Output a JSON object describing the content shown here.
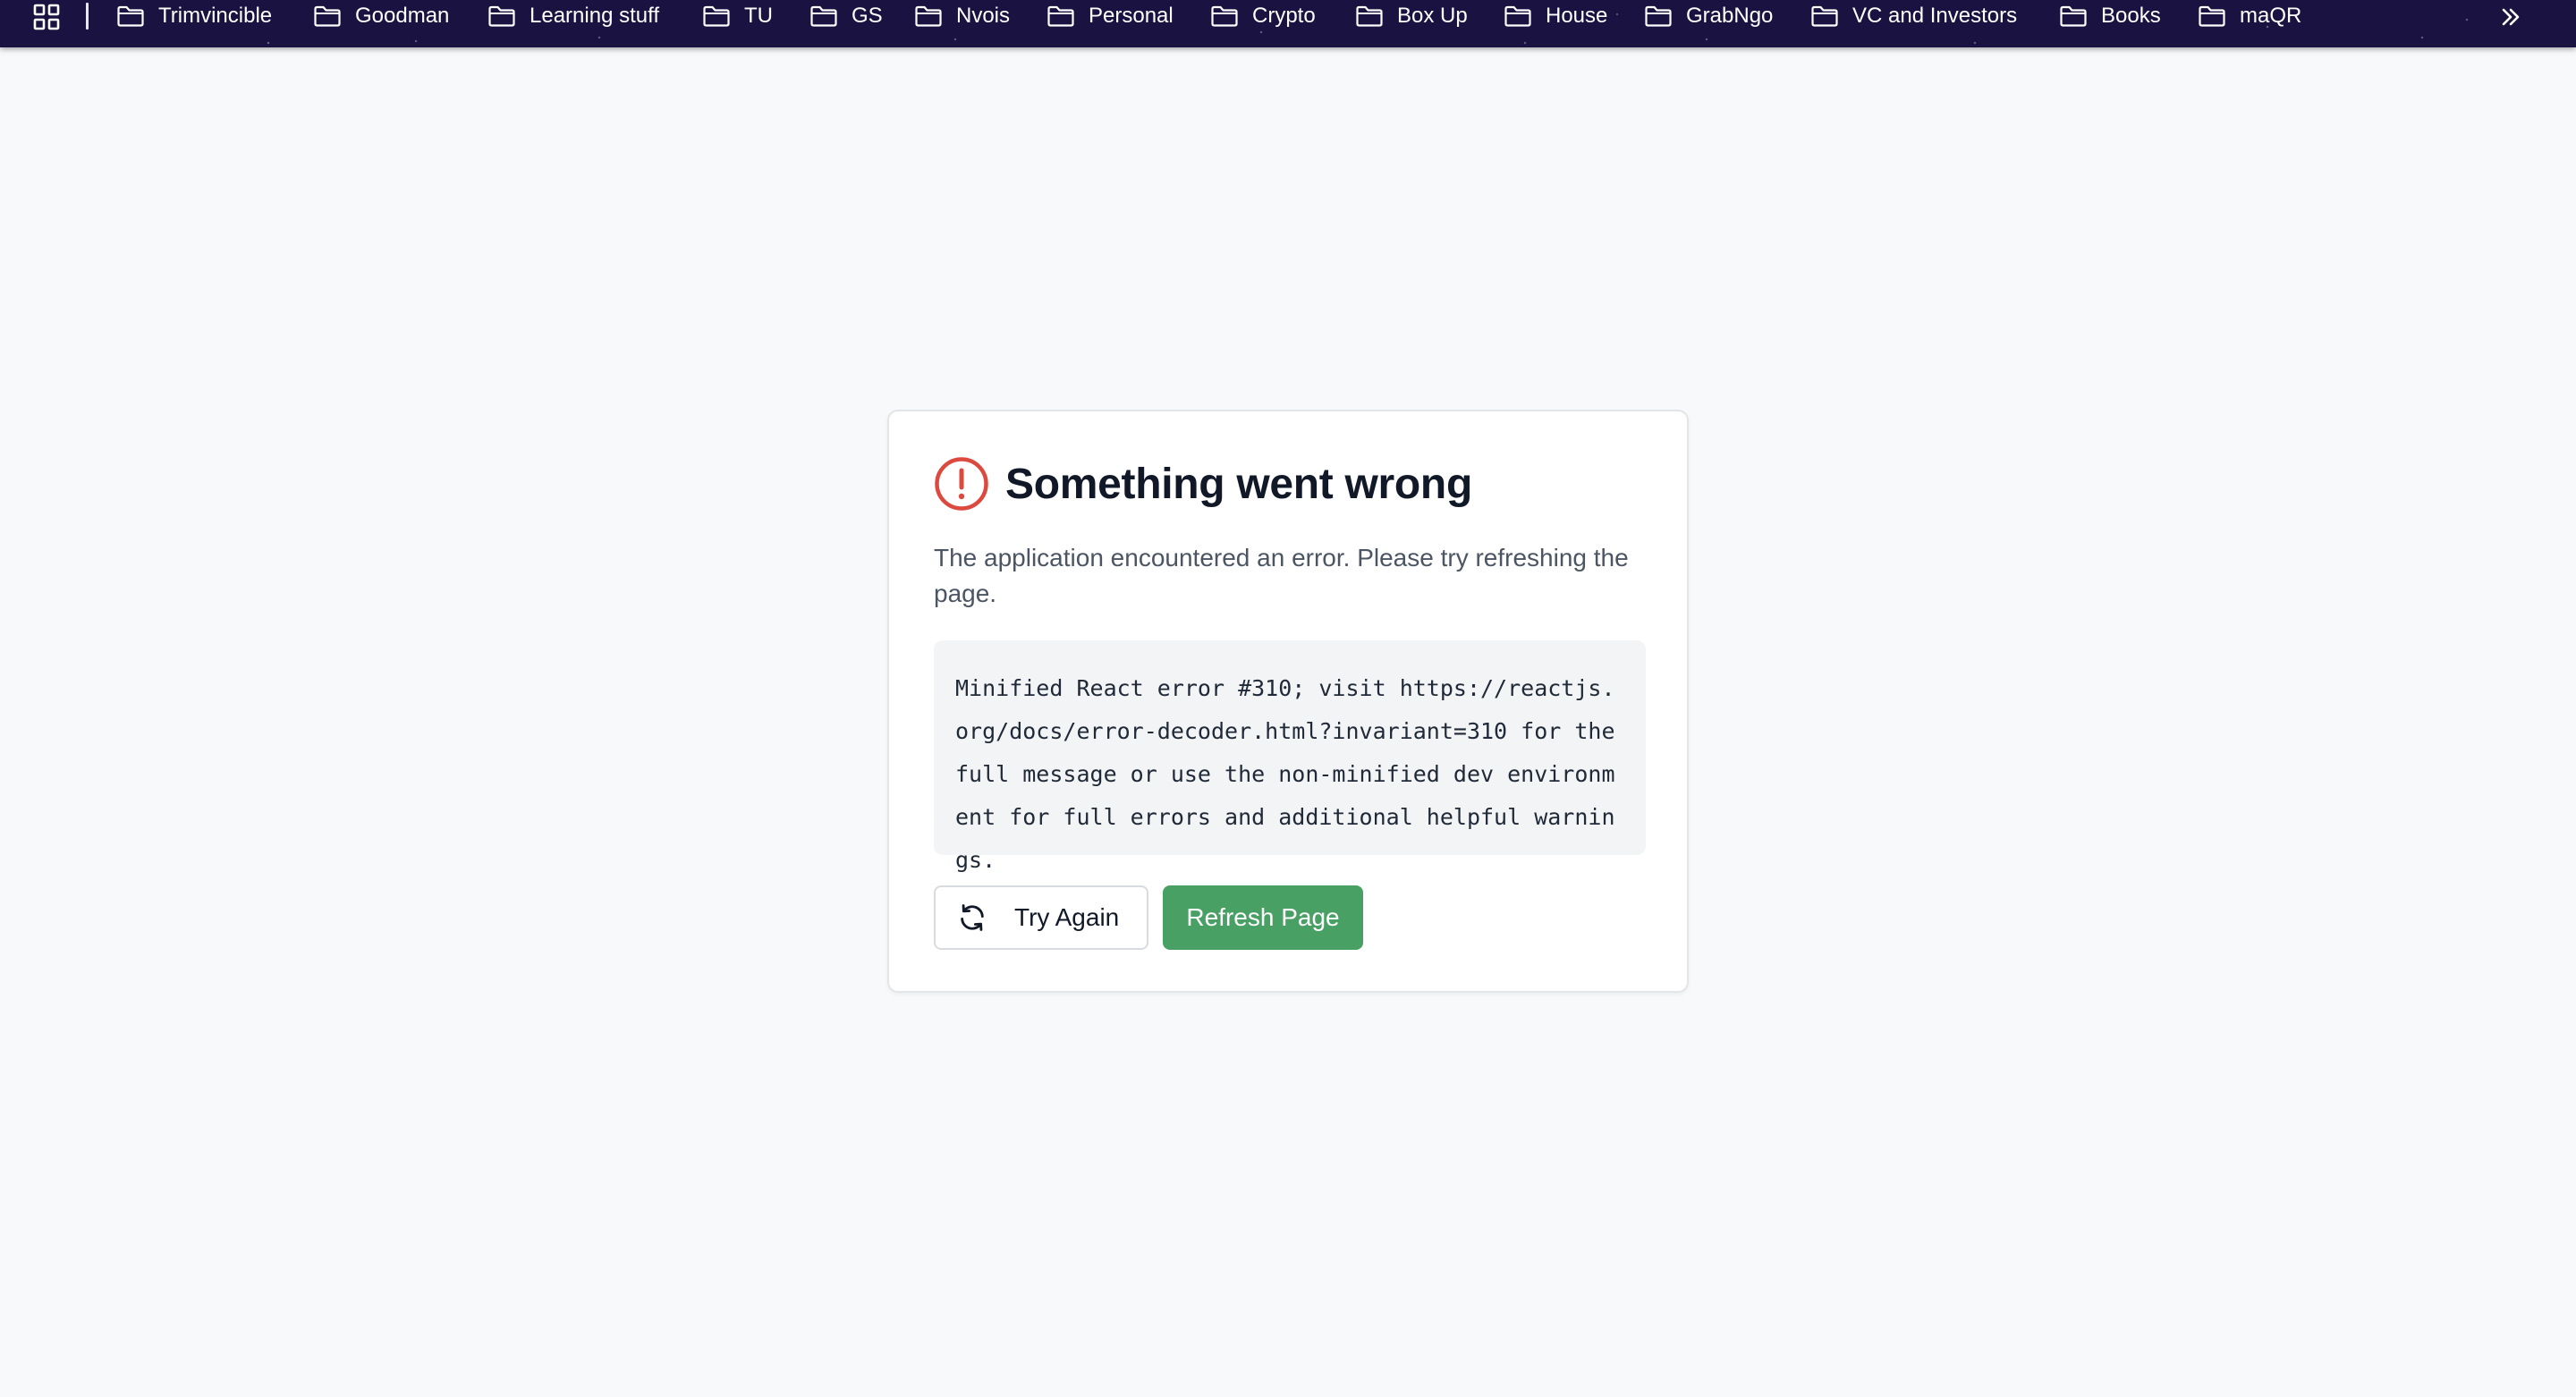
{
  "bookmarks_bar": {
    "apps_icon": "apps-grid-icon",
    "overflow_icon": "chevron-double-right-icon",
    "items": [
      {
        "label": "Trimvincible",
        "icon": "folder-icon"
      },
      {
        "label": "Goodman",
        "icon": "folder-icon"
      },
      {
        "label": "Learning stuff",
        "icon": "folder-icon"
      },
      {
        "label": "TU",
        "icon": "folder-icon"
      },
      {
        "label": "GS",
        "icon": "folder-icon"
      },
      {
        "label": "Nvois",
        "icon": "folder-icon"
      },
      {
        "label": "Personal",
        "icon": "folder-icon"
      },
      {
        "label": "Crypto",
        "icon": "folder-icon"
      },
      {
        "label": "Box Up",
        "icon": "folder-icon"
      },
      {
        "label": "House",
        "icon": "folder-icon"
      },
      {
        "label": "GrabNgo",
        "icon": "folder-icon"
      },
      {
        "label": "VC and Investors",
        "icon": "folder-icon"
      },
      {
        "label": "Books",
        "icon": "folder-icon"
      },
      {
        "label": "maQR",
        "icon": "folder-icon"
      }
    ]
  },
  "error_card": {
    "icon": "alert-circle-icon",
    "title": "Something went wrong",
    "message": "The application encountered an error. Please try refreshing the page.",
    "error_details": "Minified React error #310; visit https://reactjs.org/docs/error-decoder.html?invariant=310 for the full message or use the non-minified dev environment for full errors and additional helpful warnings.",
    "try_again_label": "Try Again",
    "try_again_icon": "refresh-icon",
    "refresh_label": "Refresh Page"
  },
  "colors": {
    "bookmarks_bar_bg": "#1a1240",
    "page_bg": "#f8f9fa",
    "alert_red": "#dc4a3f",
    "primary_green": "#48a064",
    "title_text": "#111827",
    "body_text": "#4b5563"
  }
}
